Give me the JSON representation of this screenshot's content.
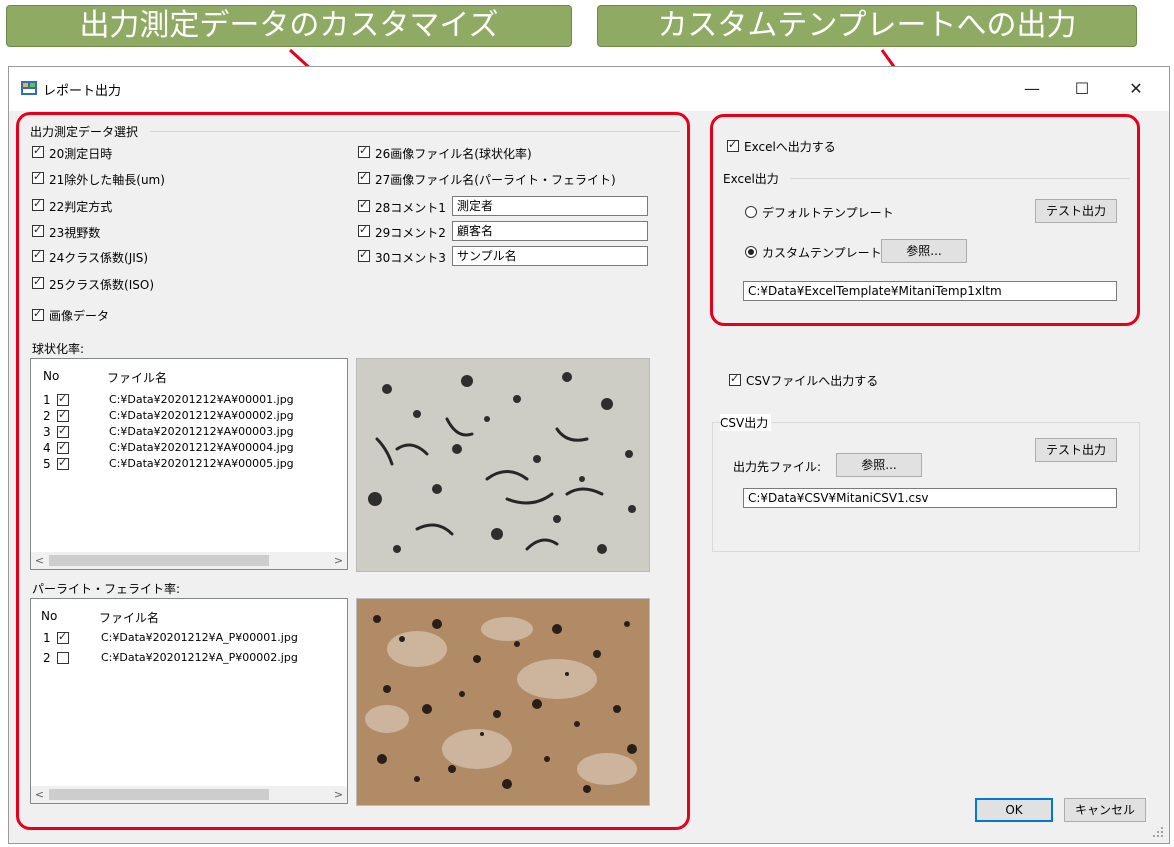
{
  "banners": {
    "left": "出力測定データのカスタマイズ",
    "right": "カスタムテンプレートへの出力"
  },
  "window": {
    "title": "レポート出力",
    "minimize": "—",
    "maximize": "☐",
    "close": "✕"
  },
  "measure_group": {
    "title": "出力測定データ選択",
    "left_items": [
      {
        "label": "20測定日時",
        "checked": true
      },
      {
        "label": "21除外した軸長(um)",
        "checked": true
      },
      {
        "label": "22判定方式",
        "checked": true
      },
      {
        "label": "23視野数",
        "checked": true
      },
      {
        "label": "24クラス係数(JIS)",
        "checked": true
      },
      {
        "label": "25クラス係数(ISO)",
        "checked": true
      }
    ],
    "right_items": [
      {
        "label": "26画像ファイル名(球状化率)",
        "checked": true
      },
      {
        "label": "27画像ファイル名(パーライト・フェライト)",
        "checked": true
      }
    ],
    "comments": [
      {
        "label": "28コメント1",
        "value": "測定者",
        "checked": true
      },
      {
        "label": "29コメント2",
        "value": "顧客名",
        "checked": true
      },
      {
        "label": "30コメント3",
        "value": "サンプル名",
        "checked": true
      }
    ],
    "image_data": {
      "label": "画像データ",
      "checked": true
    }
  },
  "spheroid": {
    "label": "球状化率:",
    "col_no": "No",
    "col_file": "ファイル名",
    "rows": [
      {
        "no": "1",
        "checked": true,
        "file": "C:¥Data¥20201212¥A¥00001.jpg"
      },
      {
        "no": "2",
        "checked": true,
        "file": "C:¥Data¥20201212¥A¥00002.jpg"
      },
      {
        "no": "3",
        "checked": true,
        "file": "C:¥Data¥20201212¥A¥00003.jpg"
      },
      {
        "no": "4",
        "checked": true,
        "file": "C:¥Data¥20201212¥A¥00004.jpg"
      },
      {
        "no": "5",
        "checked": true,
        "file": "C:¥Data¥20201212¥A¥00005.jpg"
      }
    ],
    "scroll_left": "<",
    "scroll_right": ">"
  },
  "pearlite": {
    "label": "パーライト・フェライト率:",
    "col_no": "No",
    "col_file": "ファイル名",
    "rows": [
      {
        "no": "1",
        "checked": true,
        "file": "C:¥Data¥20201212¥A_P¥00001.jpg"
      },
      {
        "no": "2",
        "checked": false,
        "file": "C:¥Data¥20201212¥A_P¥00002.jpg"
      }
    ],
    "scroll_left": "<",
    "scroll_right": ">"
  },
  "excel": {
    "output_check": {
      "label": "Excelへ出力する",
      "checked": true
    },
    "group_title": "Excel出力",
    "default_template": "デフォルトテンプレート",
    "custom_template": "カスタムテンプレート",
    "selected": "custom",
    "browse": "参照...",
    "test_output": "テスト出力",
    "path": "C:¥Data¥ExcelTemplate¥MitaniTemp1xltm"
  },
  "csv": {
    "output_check": {
      "label": "CSVファイルへ出力する",
      "checked": true
    },
    "group_title": "CSV出力",
    "dest_label": "出力先ファイル:",
    "browse": "参照...",
    "test_output": "テスト出力",
    "path": "C:¥Data¥CSV¥MitaniCSV1.csv"
  },
  "footer": {
    "ok": "OK",
    "cancel": "キャンセル"
  },
  "colors": {
    "banner": "#8faa63",
    "highlight": "#e6001a",
    "dialog_bg": "#f0f0f0",
    "focus": "#0078d7"
  }
}
